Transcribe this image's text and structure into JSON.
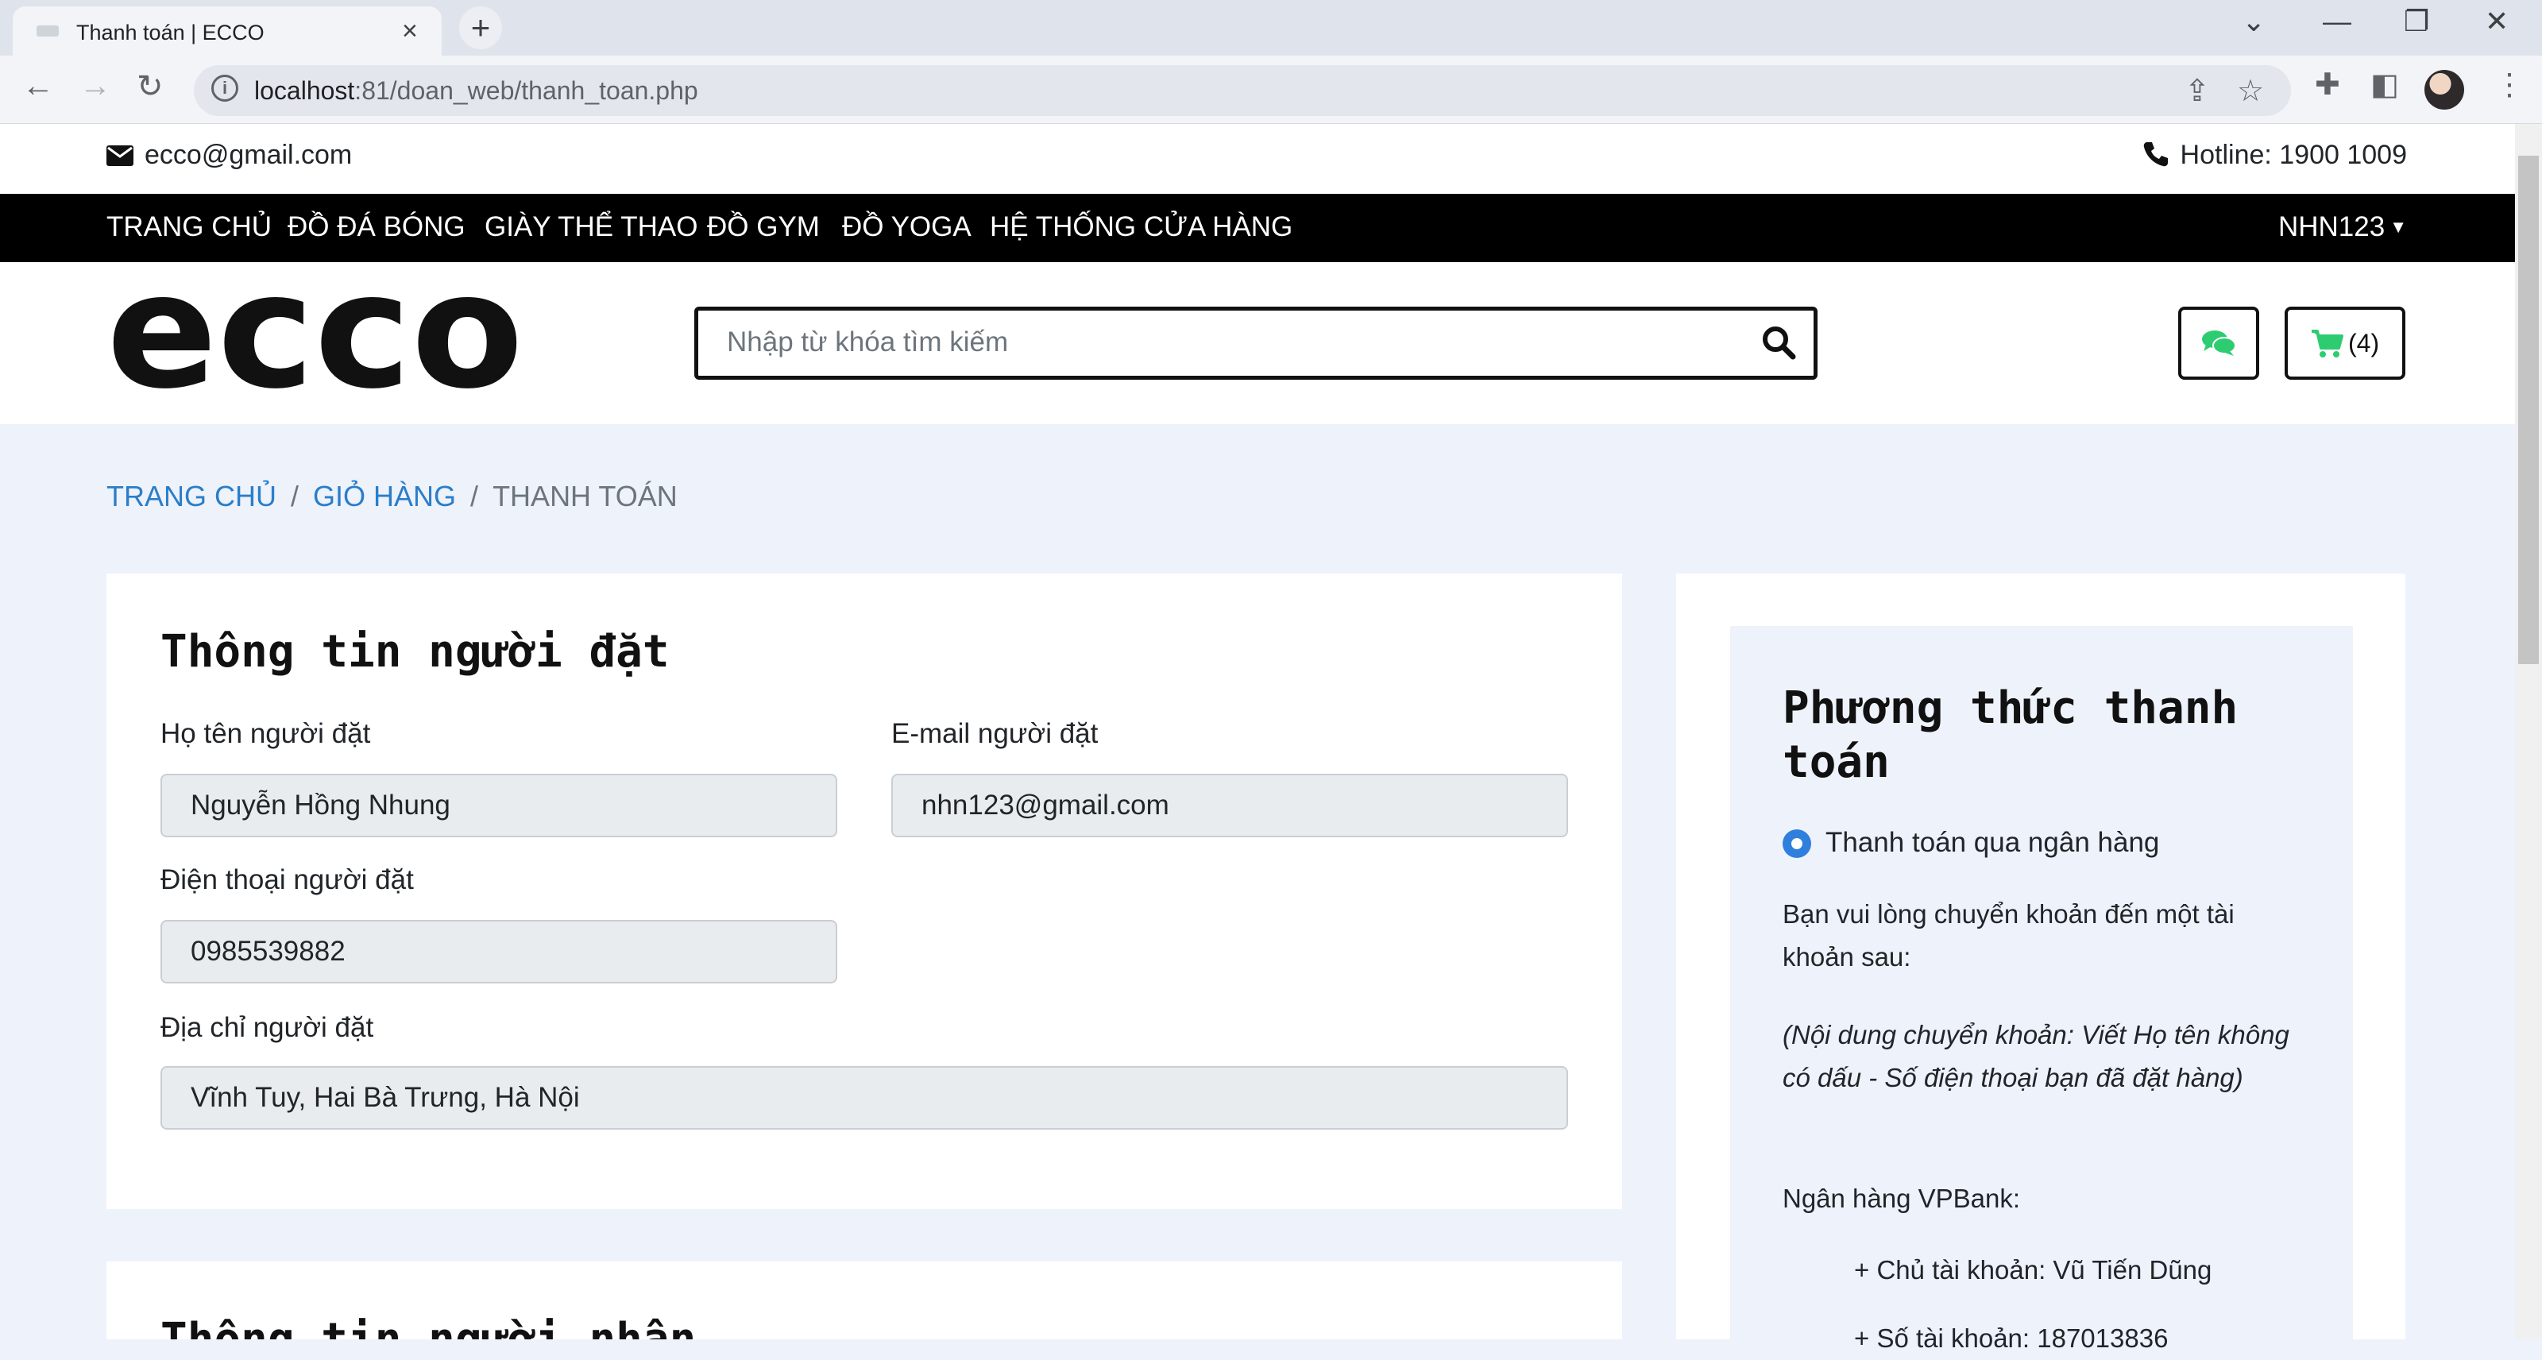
{
  "browser": {
    "tab_title": "Thanh toán | ECCO",
    "url_host": "localhost",
    "url_rest": ":81/doan_web/thanh_toan.php"
  },
  "topbar": {
    "email": "ecco@gmail.com",
    "hotline": "Hotline: 1900 1009"
  },
  "nav": {
    "items": [
      "TRANG CHỦ",
      "ĐỒ ĐÁ BÓNG",
      "GIÀY THỂ THAO",
      "ĐỒ GYM",
      "ĐỒ YOGA",
      "HỆ THỐNG CỬA HÀNG"
    ],
    "user": "NHN123"
  },
  "header": {
    "logo_text": "ecco",
    "search_placeholder": "Nhập từ khóa tìm kiếm",
    "cart_count": "(4)"
  },
  "breadcrumb": {
    "home": "TRANG CHỦ",
    "cart": "GIỎ HÀNG",
    "current": "THANH TOÁN",
    "separator": "/"
  },
  "buyer": {
    "title": "Thông tin người đặt",
    "name_label": "Họ tên người đặt",
    "name_value": "Nguyễn Hồng Nhung",
    "email_label": "E-mail người đặt",
    "email_value": "nhn123@gmail.com",
    "phone_label": "Điện thoại người đặt",
    "phone_value": "0985539882",
    "address_label": "Địa chỉ người đặt",
    "address_value": "Vĩnh Tuy, Hai Bà Trưng, Hà Nội"
  },
  "receiver": {
    "title": "Thông tin người nhận"
  },
  "payment": {
    "title": "Phương thức thanh toán",
    "option": "Thanh toán qua ngân hàng",
    "note1": "Bạn vui lòng chuyển khoản đến một tài khoản sau:",
    "note2": "(Nội dung chuyển khoản: Viết Họ tên không có dấu - Số điện thoại bạn đã đặt hàng)",
    "bank": "Ngân hàng VPBank:",
    "holder": "+ Chủ tài khoản: Vũ Tiến Dũng",
    "account": "+ Số tài khoản: 187013836"
  },
  "colors": {
    "accent_link": "#2a7ec9",
    "nav_bg": "#000000",
    "page_bg": "#eef2fb",
    "cart_icon": "#2ecc71"
  }
}
